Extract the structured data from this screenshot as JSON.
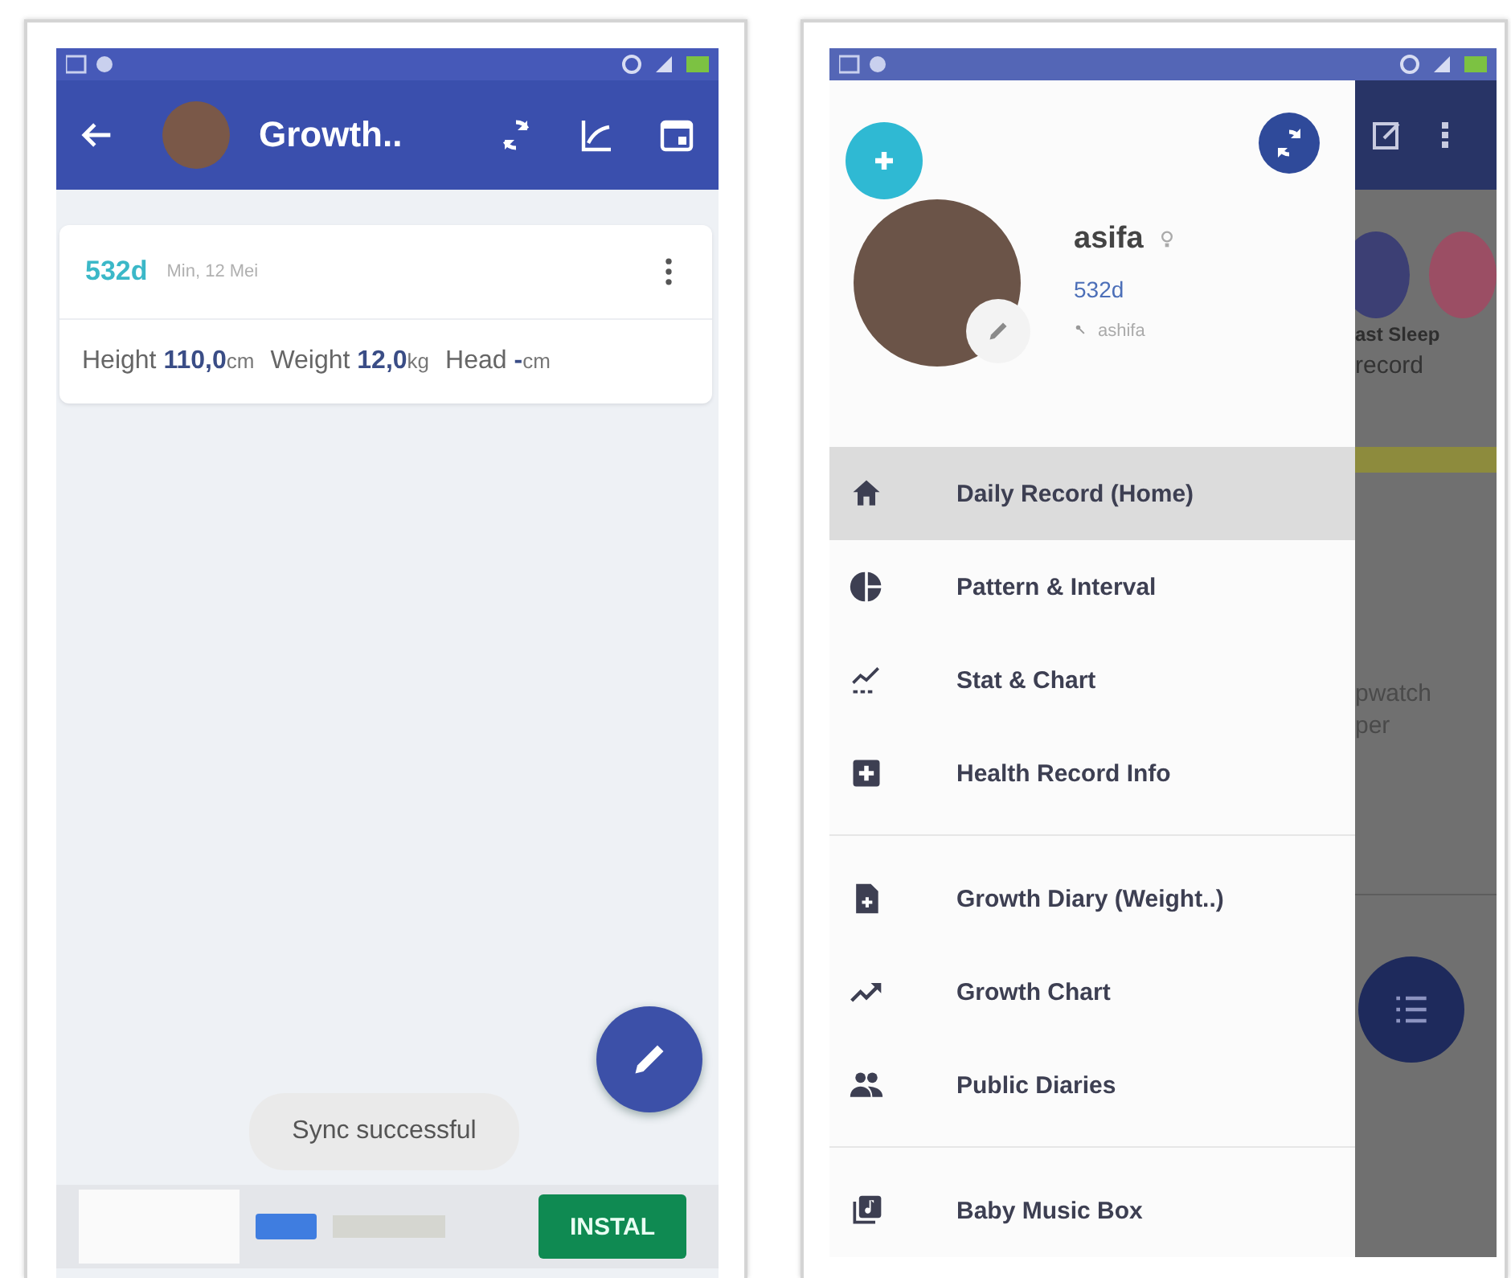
{
  "growth_screen": {
    "app_bar": {
      "title": "Growth.."
    },
    "entry": {
      "age": "532d",
      "date": "Min, 12 Mei",
      "measurements": [
        {
          "label": "Height",
          "value": "110,0",
          "unit": "cm"
        },
        {
          "label": "Weight",
          "value": "12,0",
          "unit": "kg"
        },
        {
          "label": "Head",
          "value": "-",
          "unit": "cm"
        }
      ]
    },
    "ad": {
      "install_button": "INSTAL"
    },
    "toast": "Sync successful"
  },
  "drawer_screen": {
    "profile": {
      "name": "asifa",
      "age": "532d",
      "username": "ashifa"
    },
    "menu_sections": [
      {
        "items": [
          {
            "label": "Daily Record (Home)",
            "kind": "home",
            "selected": true
          },
          {
            "label": "Pattern & Interval",
            "kind": "pie",
            "selected": false
          },
          {
            "label": "Stat & Chart",
            "kind": "stat",
            "selected": false
          },
          {
            "label": "Health Record Info",
            "kind": "health",
            "selected": false
          }
        ]
      },
      {
        "items": [
          {
            "label": "Growth Diary (Weight..)",
            "kind": "diary",
            "selected": false
          },
          {
            "label": "Growth Chart",
            "kind": "trend",
            "selected": false
          },
          {
            "label": "Public Diaries",
            "kind": "people",
            "selected": false
          }
        ]
      },
      {
        "items": [
          {
            "label": "Baby Music Box",
            "kind": "music",
            "selected": false
          }
        ]
      }
    ],
    "background": {
      "texts_top": [
        "ast Sleep",
        "record"
      ],
      "texts_middle": [
        "pwatch",
        "per"
      ]
    }
  }
}
